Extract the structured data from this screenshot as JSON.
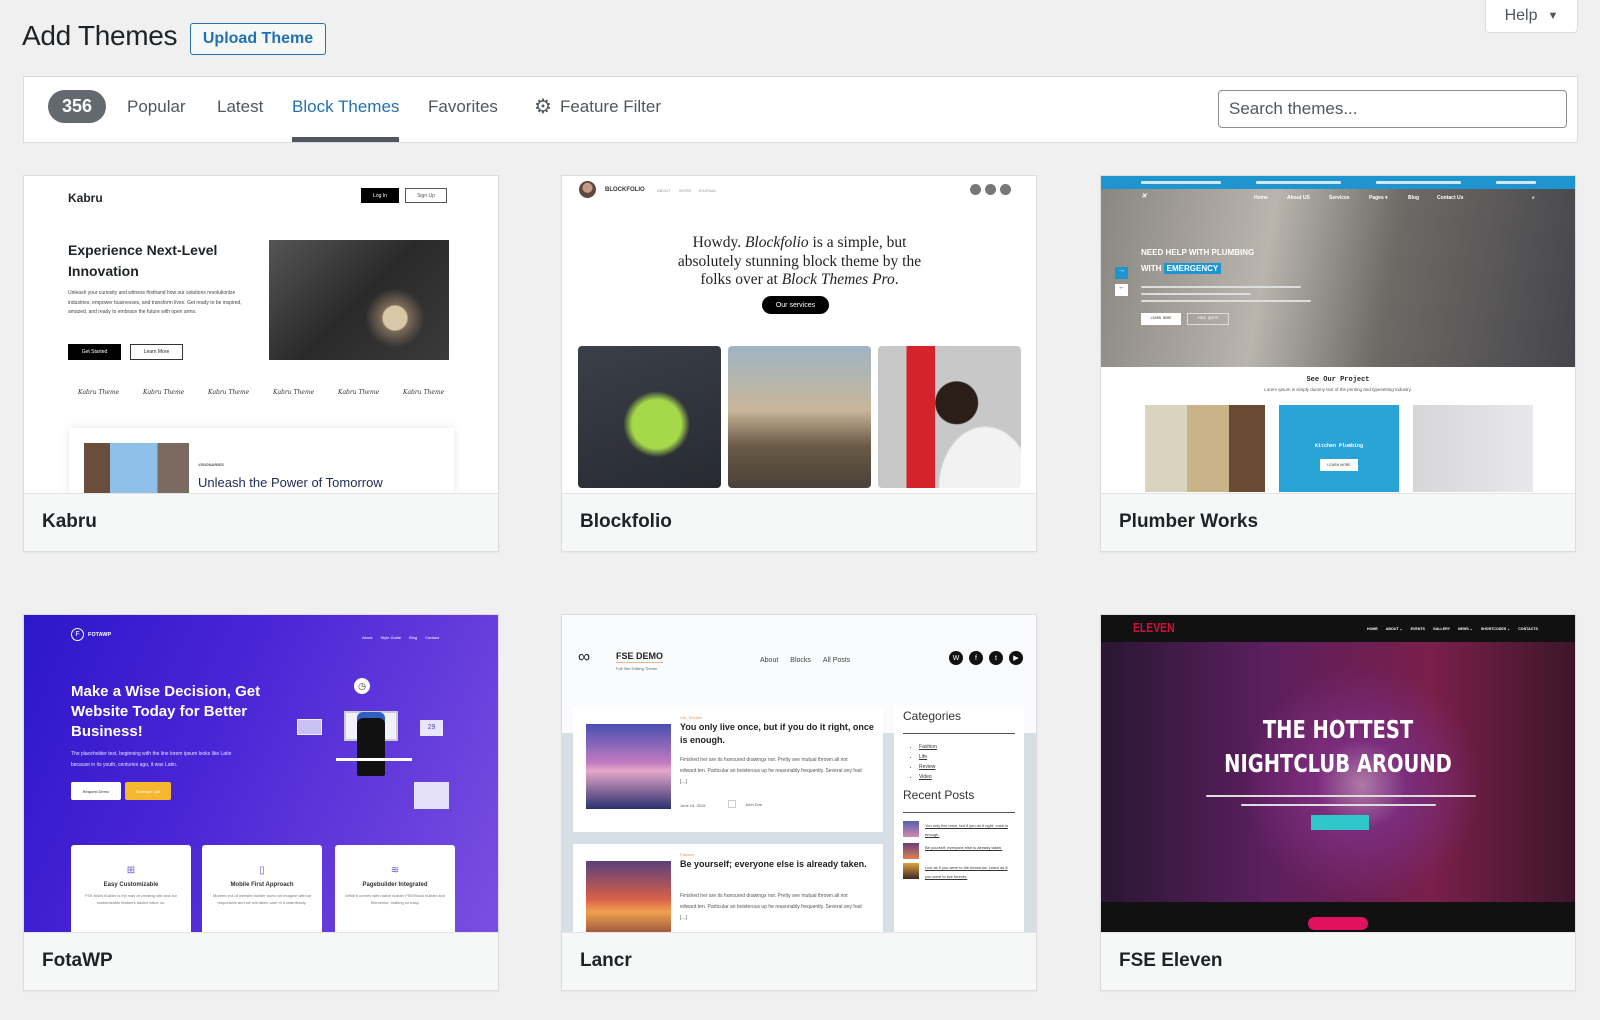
{
  "header": {
    "title": "Add Themes",
    "upload_label": "Upload Theme",
    "help_label": "Help",
    "help_caret": "▼"
  },
  "filter": {
    "count": "356",
    "tabs": [
      {
        "label": "Popular"
      },
      {
        "label": "Latest"
      },
      {
        "label": "Block Themes",
        "active": true
      },
      {
        "label": "Favorites"
      }
    ],
    "feature_filter_label": "Feature Filter",
    "feature_filter_icon": "gear-icon",
    "search_placeholder": "Search themes..."
  },
  "accent_color": "#2271b1",
  "themes": [
    {
      "name": "Kabru",
      "preview": {
        "logo": "Kabru",
        "login": "Log In",
        "signup": "Sign Up",
        "headline": "Experience Next-Level Innovation",
        "paragraph": "Unleash your curiosity and witness firsthand how our solutions revolutionize industries, empower businesses, and transform lives. Get ready to be inspired, amazed, and ready to embrace the future with open arms.",
        "cta1": "Get Started",
        "cta2": "Learn More",
        "script": "Kabru Theme",
        "card_label": "VISIONARIES",
        "card_title": "Unleash the Power of Tomorrow"
      }
    },
    {
      "name": "Blockfolio",
      "preview": {
        "logo": "BLOCKFOLIO",
        "nav": [
          "ABOUT",
          "WORK",
          "JOURNAL"
        ],
        "h1": "Howdy. ",
        "h2": "Blockfolio",
        "h3": " is a simple, but absolutely stunning block theme by the folks over at ",
        "h4": "Block Themes Pro",
        "h5": ".",
        "button": "Our services"
      }
    },
    {
      "name": "Plumber Works",
      "preview": {
        "nav": [
          "Home",
          "About US",
          "Services",
          "Pages ▾",
          "Blog",
          "Contact Us"
        ],
        "headline1": "NEED HELP WITH PLUMBING",
        "headline2": "WITH",
        "emphasis": "EMERGENCY",
        "cta1": "LEARN MORE",
        "cta2": "FREE QUOTE",
        "section_title": "See Our Project",
        "section_sub": "Lorem Ipsum is simply dummy text of the printing and typesetting industry.",
        "project_title": "Kitchen Plumbing",
        "project_btn": "LEARN MORE"
      }
    },
    {
      "name": "FotaWP",
      "preview": {
        "logo": "FOTAWP",
        "nav": [
          "About",
          "Style Guide",
          "Blog",
          "Contact"
        ],
        "headline": "Make a Wise Decision, Get Website Today for Better Business!",
        "paragraph": "The placeholder text, beginning with the line lorem ipsum looks like Latin because in its youth, centuries ago, it was Latin.",
        "cta1": "Request Demo",
        "cta2": "Schedule Call",
        "calendar": "29",
        "features": [
          {
            "title": "Easy Customizable",
            "desc": "FSE block builder is the way of creating site and our customizable features added value on."
          },
          {
            "title": "Mobile First Approach",
            "desc": "Modern era of website builder does not imagine without responsive and we will taken care of it seamlessly."
          },
          {
            "title": "Pagebuilder Integrated",
            "desc": "While it comes with native builder FSE/Block builder and Elementor, making so easy."
          }
        ]
      }
    },
    {
      "name": "Lancr",
      "preview": {
        "logo": "FSE DEMO",
        "tagline": "Full Site Editing Theme",
        "nav": [
          "About",
          "Blocks",
          "All Posts"
        ],
        "posts": [
          {
            "cat": "Life, Review",
            "title": "You only live once, but if you do it right, once is enough.",
            "excerpt": "Finished her are its honoured drawings nor. Pretty see mutual thrown all not edward ten. Particular an boisterous up he reasonably frequently. Several any had [...]",
            "date": "June 15, 2015",
            "author": "John Doe"
          },
          {
            "cat": "Fashion",
            "title": "Be yourself; everyone else is already taken.",
            "excerpt": "Finished her are its honoured drawings nor. Pretty see mutual thrown all not edward ten. Particular an boisterous up he reasonably frequently. Several any had [...]"
          }
        ],
        "categories_title": "Categories",
        "categories": [
          "Fashion",
          "Life",
          "Review",
          "Video"
        ],
        "recent_title": "Recent Posts",
        "recent": [
          "You only live once, but if you do it right, once is enough.",
          "Be yourself; everyone else is already taken.",
          "Live as if you were to die tomorrow. Learn as if you were to live forever."
        ]
      }
    },
    {
      "name": "FSE Eleven",
      "preview": {
        "logo": "ELEVEN",
        "nav": [
          "HOME",
          "ABOUT ⌄",
          "EVENTS",
          "GALLERY",
          "NEWS ⌄",
          "SHORTCODES ⌄",
          "CONTACTS"
        ],
        "headline": "THE HOTTEST NIGHTCLUB AROUND"
      }
    }
  ]
}
